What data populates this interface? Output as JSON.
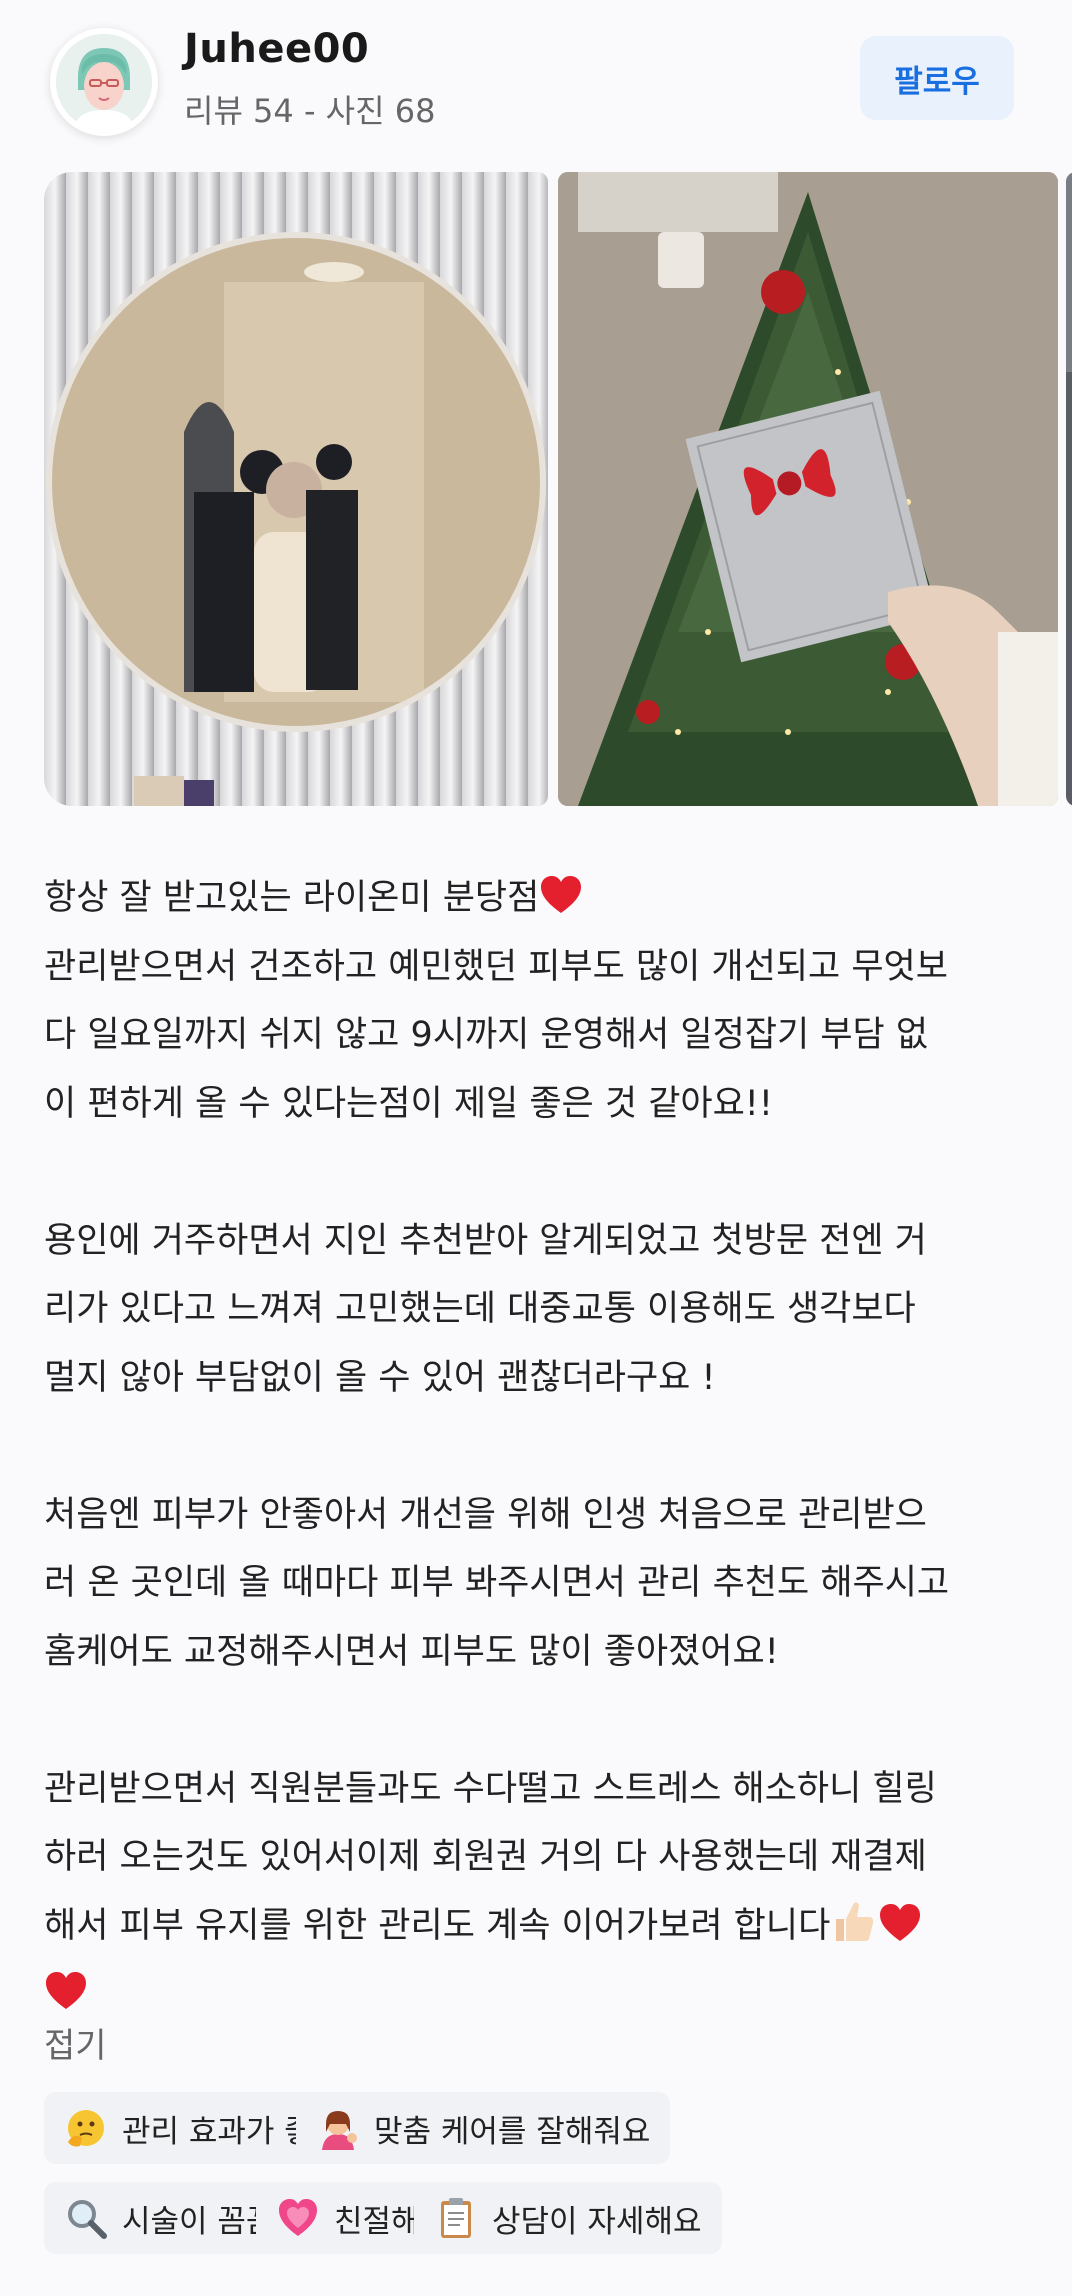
{
  "profile": {
    "username": "Juhee00",
    "stats": "리뷰 54 - 사진 68",
    "follow_label": "팔로우"
  },
  "review": {
    "lines": [
      "항상 잘 받고있는 라이온미 분당점",
      "관리받으면서 건조하고 예민했던 피부도 많이 개선되고 무엇보",
      "다 일요일까지 쉬지 않고 9시까지 운영해서 일정잡기 부담 없",
      "이 편하게 올 수 있다는점이 제일 좋은 것 같아요!!",
      "용인에 거주하면서 지인 추천받아 알게되었고 첫방문 전엔 거",
      "리가 있다고 느껴져 고민했는데 대중교통 이용해도 생각보다",
      "멀지 않아 부담없이 올 수 있어 괜찮더라구요 !",
      "처음엔 피부가 안좋아서 개선을 위해 인생 처음으로 관리받으",
      "러 온 곳인데 올 때마다 피부 봐주시면서 관리 추천도 해주시고",
      "홈케어도 교정해주시면서 피부도 많이 좋아졌어요!",
      "관리받으면서 직원분들과도 수다떨고 스트레스 해소하니 힐링",
      "하러 오는것도 있어서이제 회원권 거의 다 사용했는데 재결제",
      "해서 피부 유지를 위한 관리도 계속 이어가보려 합니다"
    ],
    "fold_label": "접기"
  },
  "tags": [
    {
      "label": "관리 효과가 좋아요",
      "icon": "thinking-face-icon"
    },
    {
      "label": "맞춤 케어를 잘해줘요",
      "icon": "person-tipping-hand-icon"
    },
    {
      "label": "시술이 꼼꼼해요",
      "icon": "magnifier-icon"
    },
    {
      "label": "친절해요",
      "icon": "growing-heart-icon"
    },
    {
      "label": "상담이 자세해요",
      "icon": "clipboard-icon"
    }
  ],
  "colors": {
    "accent": "#1a6fe0",
    "follow_bg": "#e9f1fd",
    "tag_bg": "#f1f2f5",
    "heart": "#e5202e"
  }
}
